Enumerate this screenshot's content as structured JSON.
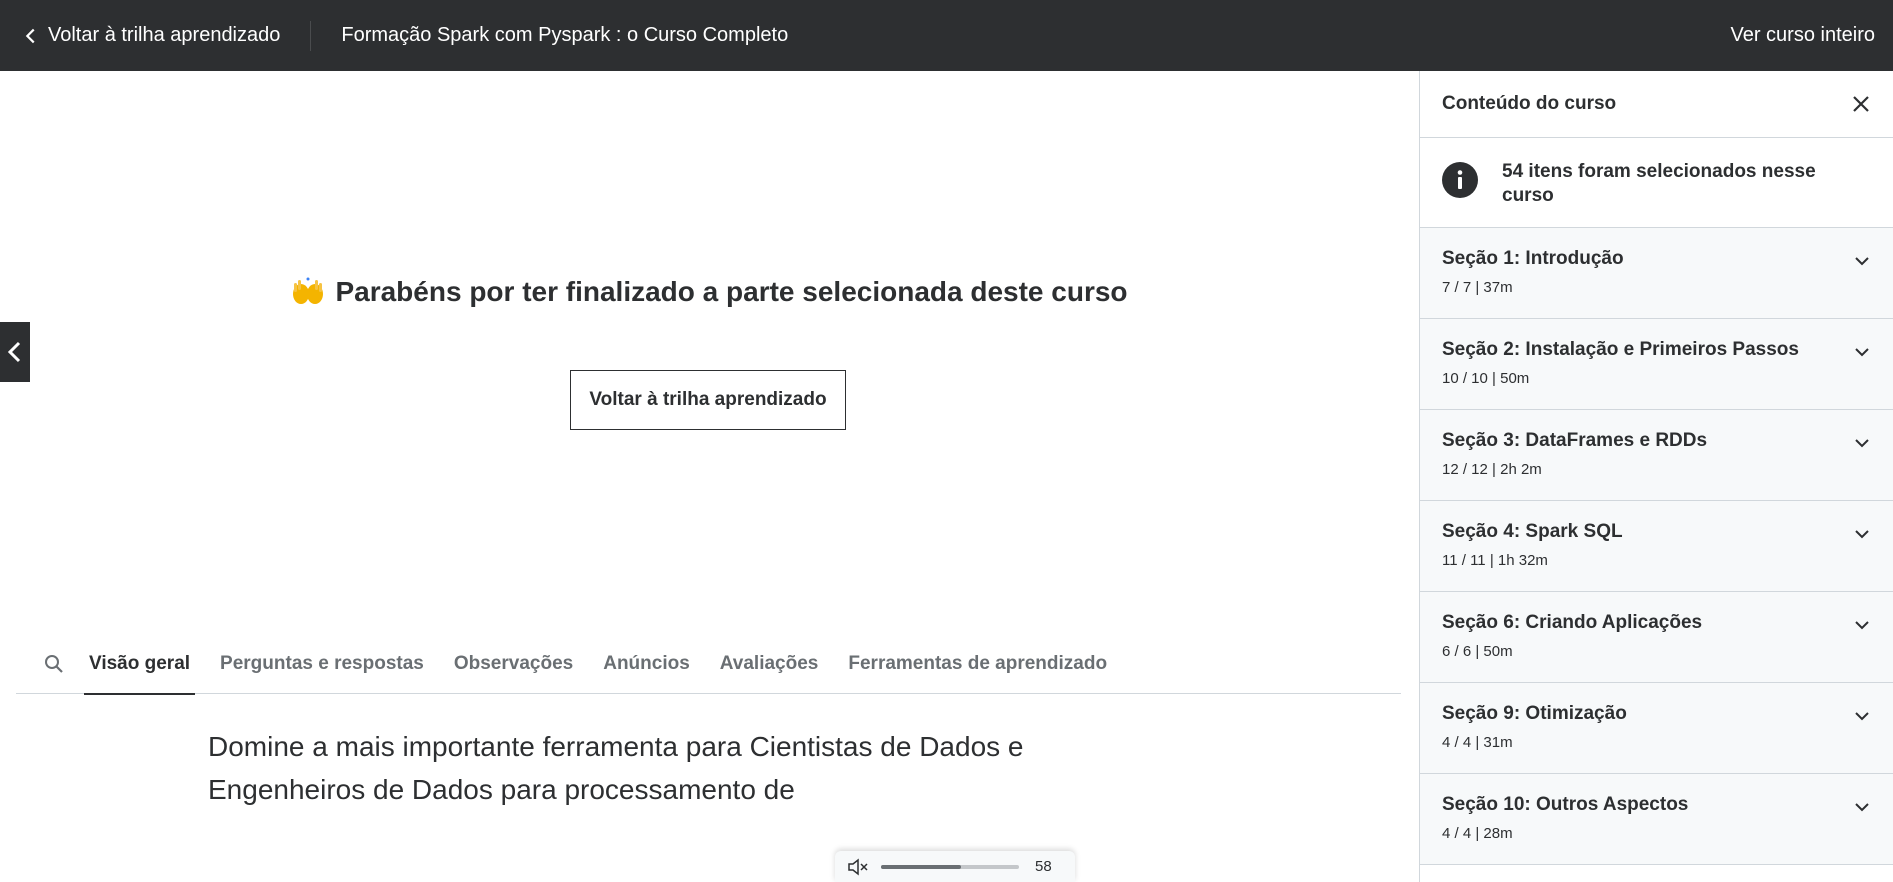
{
  "topbar": {
    "back_label": "Voltar à trilha aprendizado",
    "course_title": "Formação Spark com Pyspark : o Curso Completo",
    "see_full_label": "Ver curso inteiro"
  },
  "main": {
    "congrats_text": "Parabéns por ter finalizado a parte selecionada deste curso",
    "back_button_label": "Voltar à trilha aprendizado",
    "tabs": [
      {
        "label": "Visão geral",
        "active": true
      },
      {
        "label": "Perguntas e respostas",
        "active": false
      },
      {
        "label": "Observações",
        "active": false
      },
      {
        "label": "Anúncios",
        "active": false
      },
      {
        "label": "Avaliações",
        "active": false
      },
      {
        "label": "Ferramentas de aprendizado",
        "active": false
      }
    ],
    "overview_text": "Domine a mais importante ferramenta para Cientistas de Dados e Engenheiros de Dados para processamento de"
  },
  "mini_player": {
    "volume_value": "58",
    "volume_fraction": 0.58
  },
  "sidebar": {
    "title": "Conteúdo do curso",
    "info_text": "54 itens foram selecionados nesse curso",
    "sections": [
      {
        "title": "Seção 1: Introdução",
        "meta": "7 / 7 | 37m"
      },
      {
        "title": "Seção 2: Instalação e Primeiros Passos",
        "meta": "10 / 10 | 50m"
      },
      {
        "title": "Seção 3: DataFrames e RDDs",
        "meta": "12 / 12 | 2h 2m"
      },
      {
        "title": "Seção 4: Spark SQL",
        "meta": "11 / 11 | 1h 32m"
      },
      {
        "title": "Seção 6: Criando Aplicações",
        "meta": "6 / 6 | 50m"
      },
      {
        "title": "Seção 9: Otimização",
        "meta": "4 / 4 | 31m"
      },
      {
        "title": "Seção 10: Outros Aspectos",
        "meta": "4 / 4 | 28m"
      }
    ]
  },
  "colors": {
    "topbar_bg": "#2d2f31",
    "section_bg": "#f7f9fa",
    "muted_text": "#6a6f73"
  }
}
